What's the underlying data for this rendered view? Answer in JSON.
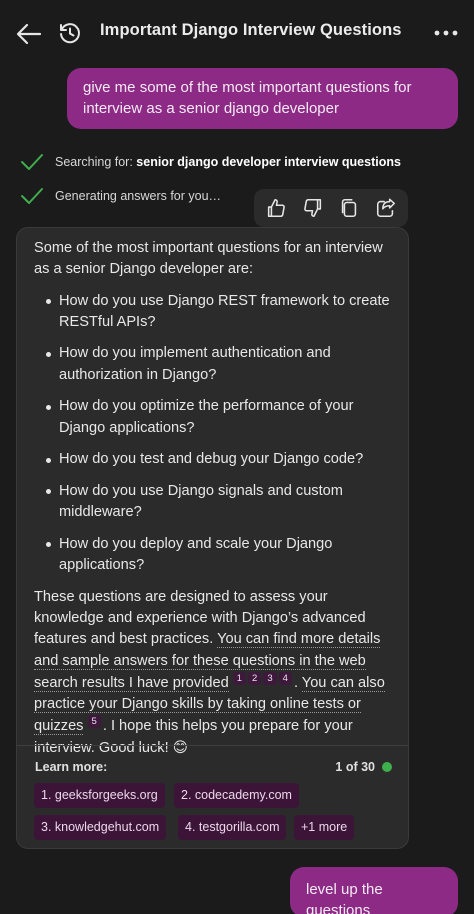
{
  "header": {
    "title": "Important Django Interview Questions",
    "back_icon": "arrow-left-icon",
    "history_icon": "history-icon",
    "more_icon": "more-horizontal-icon"
  },
  "messages": {
    "user_first": "give me some of the most important questions for interview as a senior django developer",
    "user_second": "level up the questions"
  },
  "status": {
    "searching_prefix": "Searching for: ",
    "searching_query": "senior django developer interview questions",
    "generating": "Generating answers for you…"
  },
  "actions": {
    "like": "thumbs-up-icon",
    "dislike": "thumbs-down-icon",
    "copy": "copy-icon",
    "share": "share-icon"
  },
  "answer": {
    "intro": "Some of the most important questions for an interview as a senior Django developer are:",
    "questions": [
      "How do you use Django REST framework to create RESTful APIs?",
      "How do you implement authentication and authorization in Django?",
      "How do you optimize the performance of your Django applications?",
      "How do you test and debug your Django code?",
      "How do you use Django signals and custom middleware?",
      "How do you deploy and scale your Django applications?"
    ],
    "outro_start": "These questions are designed to assess your knowledge and experience with Django’s advanced features and best practices. ",
    "outro_link1": "You can find more details and sample answers for these questions in the web search results I have provided",
    "citations1": [
      "1",
      "2",
      "3",
      "4"
    ],
    "outro_mid": ". ",
    "outro_link2": "You can also practice your Django skills by taking online tests or quizzes",
    "citations2": [
      "5"
    ],
    "outro_end": ". I hope this helps you prepare for your interview. Good luck! 😊"
  },
  "learn_more": {
    "label": "Learn more:",
    "page": "1 of 30",
    "links": [
      "1. geeksforgeeks.org",
      "2. codecademy.com",
      "3. knowledgehut.com",
      "4. testgorilla.com",
      "+1 more"
    ]
  },
  "colors": {
    "user_bubble": "#8c2a86",
    "chip": "#3b1438",
    "check": "#3fae4d",
    "background": "#1b1b1b",
    "card": "#2b2b2b"
  }
}
